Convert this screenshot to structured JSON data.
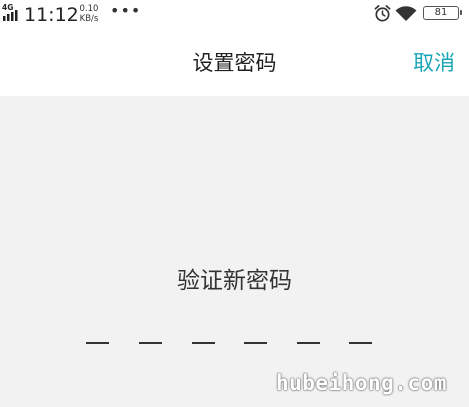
{
  "status_bar": {
    "network": "4G",
    "time": "11:12",
    "speed_value": "0.10",
    "speed_unit": "KB/s",
    "more": "•••",
    "battery_level": "81",
    "icons": [
      "signal-icon",
      "alarm-clock-icon",
      "wifi-icon",
      "battery-icon"
    ]
  },
  "nav": {
    "title": "设置密码",
    "cancel_label": "取消"
  },
  "main": {
    "prompt": "验证新密码",
    "pin_slots": 6,
    "pin_filled": 0
  },
  "watermark": "hubeihong.com",
  "colors": {
    "accent": "#1aa6b7",
    "background": "#f2f2f2",
    "header": "#ffffff",
    "text": "#333333"
  }
}
